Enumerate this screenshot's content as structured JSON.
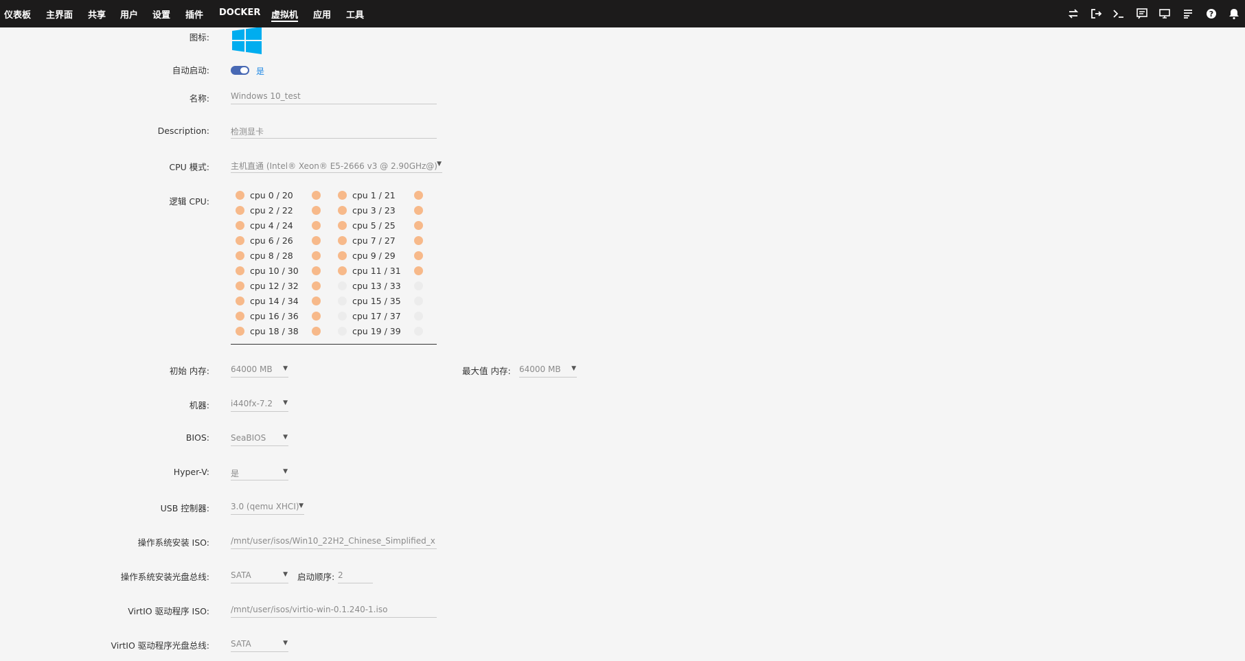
{
  "nav": {
    "items": [
      {
        "label": "仪表板",
        "active": false
      },
      {
        "label": "主界面",
        "active": false
      },
      {
        "label": "共享",
        "active": false
      },
      {
        "label": "用户",
        "active": false
      },
      {
        "label": "设置",
        "active": false
      },
      {
        "label": "插件",
        "active": false
      },
      {
        "label": "DOCKER",
        "active": false
      },
      {
        "label": "虚拟机",
        "active": true
      },
      {
        "label": "应用",
        "active": false
      },
      {
        "label": "工具",
        "active": false
      }
    ],
    "icons": [
      "switch-icon",
      "logout-icon",
      "terminal-icon",
      "feedback-icon",
      "monitor-icon",
      "log-icon",
      "help-icon",
      "bell-icon"
    ]
  },
  "colors": {
    "accent": "#4869b4",
    "cpu_on": "#f7b98a",
    "cpu_off": "#ececec",
    "link": "#1e88e5",
    "topbar": "#1c1b1b"
  },
  "form": {
    "icon_label": "图标:",
    "icon_name": "windows-logo-icon",
    "autostart_label": "自动启动:",
    "autostart_value": "是",
    "autostart_on": true,
    "name_label": "名称:",
    "name_value": "Windows 10_test",
    "description_label": "Description:",
    "description_value": "检测显卡",
    "cpu_mode_label": "CPU 模式:",
    "cpu_mode_value": "主机直通 (Intel® Xeon® E5-2666 v3 @ 2.90GHz@)",
    "logical_cpu_label": "逻辑 CPU:",
    "cpus": [
      {
        "label": "cpu 0 / 20",
        "a": true,
        "b": true
      },
      {
        "label": "cpu 1 / 21",
        "a": true,
        "b": true
      },
      {
        "label": "cpu 2 / 22",
        "a": true,
        "b": true
      },
      {
        "label": "cpu 3 / 23",
        "a": true,
        "b": true
      },
      {
        "label": "cpu 4 / 24",
        "a": true,
        "b": true
      },
      {
        "label": "cpu 5 / 25",
        "a": true,
        "b": true
      },
      {
        "label": "cpu 6 / 26",
        "a": true,
        "b": true
      },
      {
        "label": "cpu 7 / 27",
        "a": true,
        "b": true
      },
      {
        "label": "cpu 8 / 28",
        "a": true,
        "b": true
      },
      {
        "label": "cpu 9 / 29",
        "a": true,
        "b": true
      },
      {
        "label": "cpu 10 / 30",
        "a": true,
        "b": true
      },
      {
        "label": "cpu 11 / 31",
        "a": true,
        "b": true
      },
      {
        "label": "cpu 12 / 32",
        "a": true,
        "b": true
      },
      {
        "label": "cpu 13 / 33",
        "a": false,
        "b": false
      },
      {
        "label": "cpu 14 / 34",
        "a": true,
        "b": true
      },
      {
        "label": "cpu 15 / 35",
        "a": false,
        "b": false
      },
      {
        "label": "cpu 16 / 36",
        "a": true,
        "b": true
      },
      {
        "label": "cpu 17 / 37",
        "a": false,
        "b": false
      },
      {
        "label": "cpu 18 / 38",
        "a": true,
        "b": true
      },
      {
        "label": "cpu 19 / 39",
        "a": false,
        "b": false
      }
    ],
    "init_mem_label": "初始 内存:",
    "init_mem_value": "64000 MB",
    "max_mem_label": "最大值 内存:",
    "max_mem_value": "64000 MB",
    "machine_label": "机器:",
    "machine_value": "i440fx-7.2",
    "bios_label": "BIOS:",
    "bios_value": "SeaBIOS",
    "hyperv_label": "Hyper-V:",
    "hyperv_value": "是",
    "usb_label": "USB 控制器:",
    "usb_value": "3.0 (qemu XHCI)",
    "os_iso_label": "操作系统安装 ISO:",
    "os_iso_value": "/mnt/user/isos/Win10_22H2_Chinese_Simplified_x",
    "os_bus_label": "操作系统安装光盘总线:",
    "os_bus_value": "SATA",
    "boot_order_label": "启动顺序:",
    "boot_order_value": "2",
    "virtio_iso_label": "VirtIO 驱动程序 ISO:",
    "virtio_iso_value": "/mnt/user/isos/virtio-win-0.1.240-1.iso",
    "virtio_bus_label": "VirtIO 驱动程序光盘总线:",
    "virtio_bus_value": "SATA"
  }
}
